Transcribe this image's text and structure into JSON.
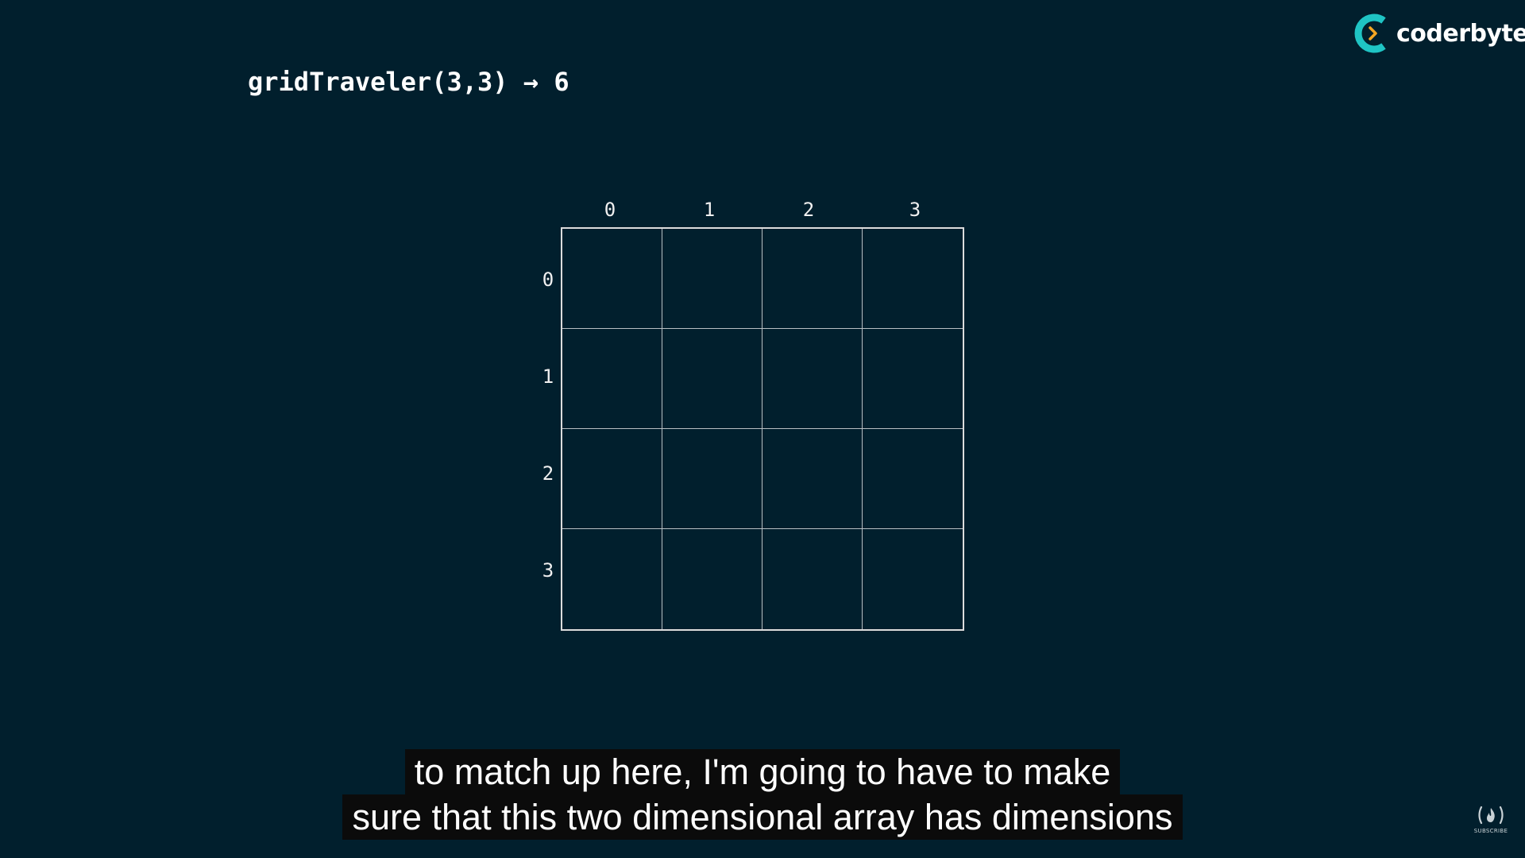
{
  "title": {
    "text": "gridTraveler(3,3) → 6"
  },
  "logo": {
    "icon": "coderbyte-logo-icon",
    "text": "coderbyte",
    "accent_color": "#1fc4c4",
    "chevron_color": "#f5a623"
  },
  "grid": {
    "columns": [
      "0",
      "1",
      "2",
      "3"
    ],
    "rows": [
      "0",
      "1",
      "2",
      "3"
    ]
  },
  "captions": {
    "line1": "to match up here, I'm going to have to make",
    "line2": "sure that this two dimensional array has dimensions"
  },
  "badge": {
    "icon": "freecodecamp-flame-icon",
    "label": "SUBSCRIBE"
  }
}
